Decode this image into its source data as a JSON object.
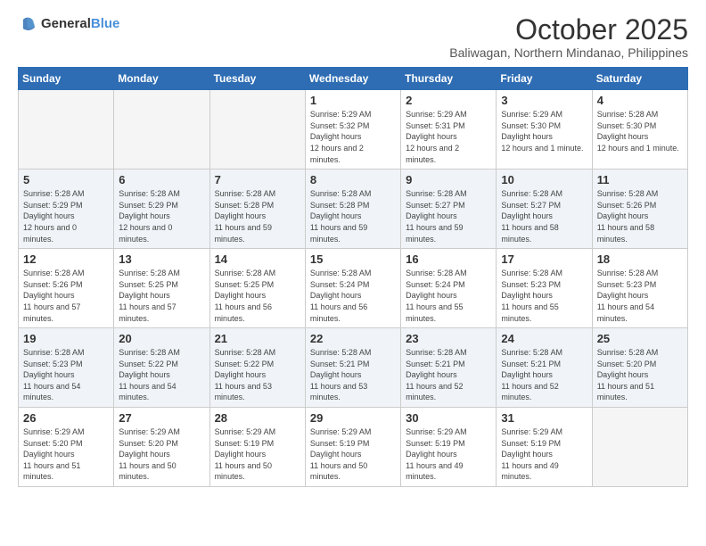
{
  "header": {
    "logo_general": "General",
    "logo_blue": "Blue",
    "month_title": "October 2025",
    "subtitle": "Baliwagan, Northern Mindanao, Philippines"
  },
  "days_of_week": [
    "Sunday",
    "Monday",
    "Tuesday",
    "Wednesday",
    "Thursday",
    "Friday",
    "Saturday"
  ],
  "weeks": [
    [
      {
        "day": "",
        "empty": true
      },
      {
        "day": "",
        "empty": true
      },
      {
        "day": "",
        "empty": true
      },
      {
        "day": "1",
        "sunrise": "5:29 AM",
        "sunset": "5:32 PM",
        "daylight": "12 hours and 2 minutes."
      },
      {
        "day": "2",
        "sunrise": "5:29 AM",
        "sunset": "5:31 PM",
        "daylight": "12 hours and 2 minutes."
      },
      {
        "day": "3",
        "sunrise": "5:29 AM",
        "sunset": "5:30 PM",
        "daylight": "12 hours and 1 minute."
      },
      {
        "day": "4",
        "sunrise": "5:28 AM",
        "sunset": "5:30 PM",
        "daylight": "12 hours and 1 minute."
      }
    ],
    [
      {
        "day": "5",
        "sunrise": "5:28 AM",
        "sunset": "5:29 PM",
        "daylight": "12 hours and 0 minutes."
      },
      {
        "day": "6",
        "sunrise": "5:28 AM",
        "sunset": "5:29 PM",
        "daylight": "12 hours and 0 minutes."
      },
      {
        "day": "7",
        "sunrise": "5:28 AM",
        "sunset": "5:28 PM",
        "daylight": "11 hours and 59 minutes."
      },
      {
        "day": "8",
        "sunrise": "5:28 AM",
        "sunset": "5:28 PM",
        "daylight": "11 hours and 59 minutes."
      },
      {
        "day": "9",
        "sunrise": "5:28 AM",
        "sunset": "5:27 PM",
        "daylight": "11 hours and 59 minutes."
      },
      {
        "day": "10",
        "sunrise": "5:28 AM",
        "sunset": "5:27 PM",
        "daylight": "11 hours and 58 minutes."
      },
      {
        "day": "11",
        "sunrise": "5:28 AM",
        "sunset": "5:26 PM",
        "daylight": "11 hours and 58 minutes."
      }
    ],
    [
      {
        "day": "12",
        "sunrise": "5:28 AM",
        "sunset": "5:26 PM",
        "daylight": "11 hours and 57 minutes."
      },
      {
        "day": "13",
        "sunrise": "5:28 AM",
        "sunset": "5:25 PM",
        "daylight": "11 hours and 57 minutes."
      },
      {
        "day": "14",
        "sunrise": "5:28 AM",
        "sunset": "5:25 PM",
        "daylight": "11 hours and 56 minutes."
      },
      {
        "day": "15",
        "sunrise": "5:28 AM",
        "sunset": "5:24 PM",
        "daylight": "11 hours and 56 minutes."
      },
      {
        "day": "16",
        "sunrise": "5:28 AM",
        "sunset": "5:24 PM",
        "daylight": "11 hours and 55 minutes."
      },
      {
        "day": "17",
        "sunrise": "5:28 AM",
        "sunset": "5:23 PM",
        "daylight": "11 hours and 55 minutes."
      },
      {
        "day": "18",
        "sunrise": "5:28 AM",
        "sunset": "5:23 PM",
        "daylight": "11 hours and 54 minutes."
      }
    ],
    [
      {
        "day": "19",
        "sunrise": "5:28 AM",
        "sunset": "5:23 PM",
        "daylight": "11 hours and 54 minutes."
      },
      {
        "day": "20",
        "sunrise": "5:28 AM",
        "sunset": "5:22 PM",
        "daylight": "11 hours and 54 minutes."
      },
      {
        "day": "21",
        "sunrise": "5:28 AM",
        "sunset": "5:22 PM",
        "daylight": "11 hours and 53 minutes."
      },
      {
        "day": "22",
        "sunrise": "5:28 AM",
        "sunset": "5:21 PM",
        "daylight": "11 hours and 53 minutes."
      },
      {
        "day": "23",
        "sunrise": "5:28 AM",
        "sunset": "5:21 PM",
        "daylight": "11 hours and 52 minutes."
      },
      {
        "day": "24",
        "sunrise": "5:28 AM",
        "sunset": "5:21 PM",
        "daylight": "11 hours and 52 minutes."
      },
      {
        "day": "25",
        "sunrise": "5:28 AM",
        "sunset": "5:20 PM",
        "daylight": "11 hours and 51 minutes."
      }
    ],
    [
      {
        "day": "26",
        "sunrise": "5:29 AM",
        "sunset": "5:20 PM",
        "daylight": "11 hours and 51 minutes."
      },
      {
        "day": "27",
        "sunrise": "5:29 AM",
        "sunset": "5:20 PM",
        "daylight": "11 hours and 50 minutes."
      },
      {
        "day": "28",
        "sunrise": "5:29 AM",
        "sunset": "5:19 PM",
        "daylight": "11 hours and 50 minutes."
      },
      {
        "day": "29",
        "sunrise": "5:29 AM",
        "sunset": "5:19 PM",
        "daylight": "11 hours and 50 minutes."
      },
      {
        "day": "30",
        "sunrise": "5:29 AM",
        "sunset": "5:19 PM",
        "daylight": "11 hours and 49 minutes."
      },
      {
        "day": "31",
        "sunrise": "5:29 AM",
        "sunset": "5:19 PM",
        "daylight": "11 hours and 49 minutes."
      },
      {
        "day": "",
        "empty": true
      }
    ]
  ]
}
